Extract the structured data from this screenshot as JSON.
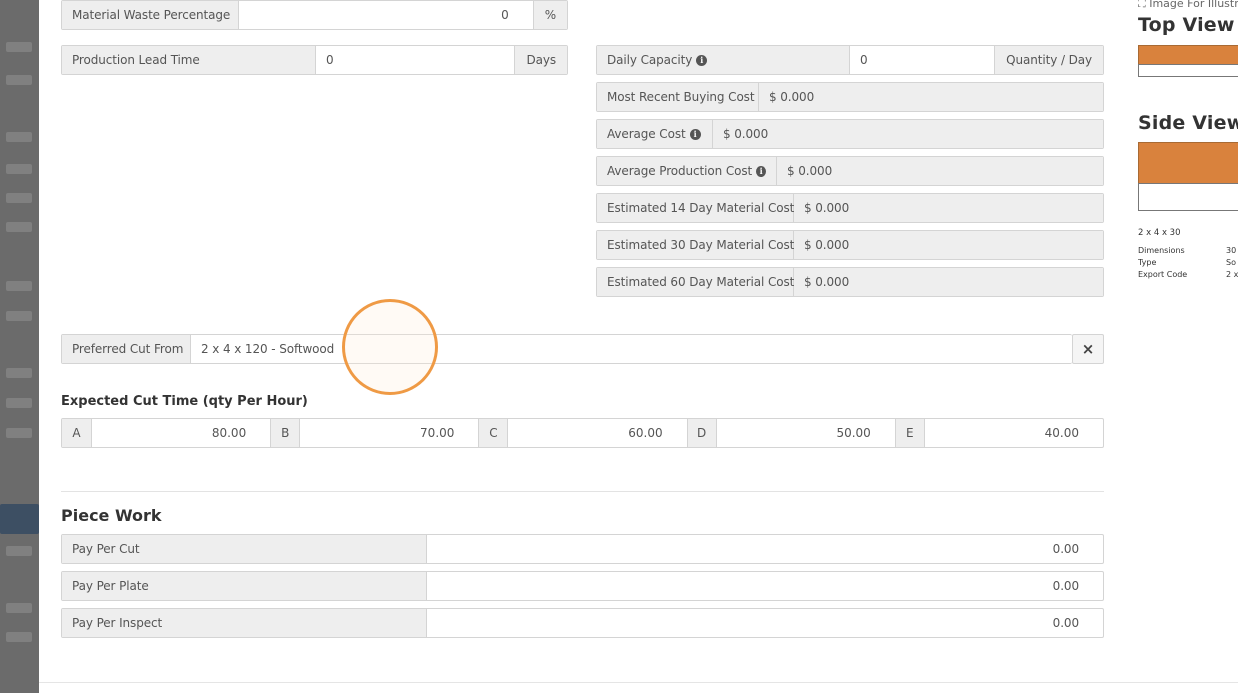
{
  "material_waste": {
    "label": "Material Waste Percentage",
    "value": "0",
    "unit": "%"
  },
  "lead_time": {
    "label": "Production Lead Time",
    "value": "0",
    "unit": "Days"
  },
  "daily_capacity": {
    "label": "Daily Capacity",
    "value": "0",
    "unit": "Quantity / Day"
  },
  "costs": [
    {
      "label": "Most Recent Buying Cost",
      "value": "$ 0.000",
      "info": false
    },
    {
      "label": "Average Cost",
      "value": "$ 0.000",
      "info": true
    },
    {
      "label": "Average Production Cost",
      "value": "$ 0.000",
      "info": true
    },
    {
      "label": "Estimated 14 Day Material Cost",
      "value": "$ 0.000",
      "info": false
    },
    {
      "label": "Estimated 30 Day Material Cost",
      "value": "$ 0.000",
      "info": false
    },
    {
      "label": "Estimated 60 Day Material Cost",
      "value": "$ 0.000",
      "info": false
    }
  ],
  "preferred_cut": {
    "label": "Preferred Cut From",
    "value": "2 x 4 x 120 - Softwood",
    "clear": "×"
  },
  "cut_time": {
    "title": "Expected Cut Time (qty Per Hour)",
    "entries": [
      {
        "key": "A",
        "value": "80.00"
      },
      {
        "key": "B",
        "value": "70.00"
      },
      {
        "key": "C",
        "value": "60.00"
      },
      {
        "key": "D",
        "value": "50.00"
      },
      {
        "key": "E",
        "value": "40.00"
      }
    ]
  },
  "piece_work": {
    "title": "Piece Work",
    "rows": [
      {
        "label": "Pay Per Cut",
        "value": "0.00"
      },
      {
        "label": "Pay Per Plate",
        "value": "0.00"
      },
      {
        "label": "Pay Per Inspect",
        "value": "0.00"
      }
    ]
  },
  "preview": {
    "caption": "Image For Illustr",
    "top_view": "Top View",
    "side_view": "Side View",
    "name": "2 x 4 x 30",
    "specs": [
      {
        "key": "Dimensions",
        "value": "30"
      },
      {
        "key": "Type",
        "value": "So"
      },
      {
        "key": "Export Code",
        "value": "2 x"
      }
    ]
  },
  "colors": {
    "wood": "#d9823d",
    "accent_cursor": "#ef9a45"
  }
}
